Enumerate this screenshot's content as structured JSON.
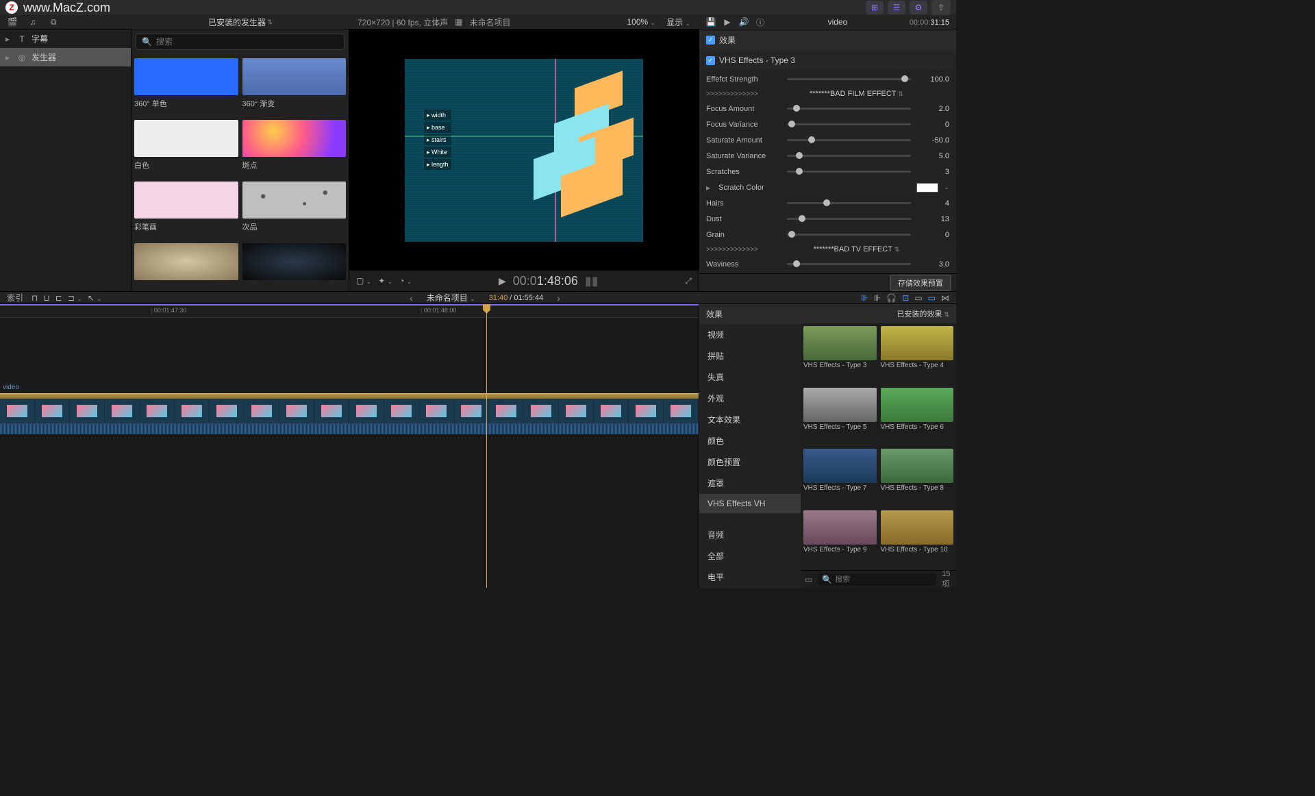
{
  "watermark": "www.MacZ.com",
  "logo_letter": "Z",
  "toolbar2": {
    "browser_title": "已安装的发生器",
    "viewer_meta": "720×720 | 60 fps, 立体声",
    "project_name": "未命名项目",
    "zoom": "100%",
    "display": "显示",
    "inspector_title": "video",
    "tc_prefix": "00:00:",
    "tc_end": "31:15"
  },
  "sidebar": {
    "items": [
      {
        "label": "字幕",
        "icon": "T"
      },
      {
        "label": "发生器",
        "icon": "◎"
      }
    ]
  },
  "browser": {
    "search_placeholder": "搜索",
    "generators": [
      {
        "label": "360° 单色",
        "css": "background: #2a6aff;"
      },
      {
        "label": "360° 渐变",
        "css": "background: linear-gradient(180deg,#6a8acf,#4a6aaa);"
      },
      {
        "label": "白色",
        "css": "background: #eee;"
      },
      {
        "label": "斑点",
        "css": "background: radial-gradient(circle at 30% 30%, #ffcc4a, #ff5a8a 40%, #8a3aff 80%);"
      },
      {
        "label": "彩笔画",
        "css": "background: #f5d5e5;"
      },
      {
        "label": "次品",
        "css": "background: #bfbfbf url() ; background-image: radial-gradient(circle at 20% 40%, #555 2%, transparent 3%), radial-gradient(circle at 60% 60%, #555 2%, transparent 3%), radial-gradient(circle at 80% 30%, #555 2%, transparent 3%); "
      },
      {
        "label": "",
        "css": "background: radial-gradient(ellipse at center, #d4c4a4, #8a7a5a);"
      },
      {
        "label": "",
        "css": "background: radial-gradient(ellipse at center, #2a3a4a, #0a0a0a);"
      }
    ]
  },
  "viewer": {
    "video_overlay_labels": [
      "width",
      "base",
      "stairs",
      "White",
      "length"
    ],
    "timecode_prefix": "00:0",
    "timecode_main": "1:48:06"
  },
  "inspector": {
    "section_effects": "效果",
    "effect_name": "VHS Effects - Type 3",
    "params": [
      {
        "label": "Effefct Strength",
        "value": "100.0",
        "pct": 95
      },
      {
        "label": "Focus Amount",
        "value": "2.0",
        "pct": 8
      },
      {
        "label": "Focus Variance",
        "value": "0",
        "pct": 4
      },
      {
        "label": "Saturate Amount",
        "value": "-50.0",
        "pct": 20
      },
      {
        "label": "Saturate Variance",
        "value": "5.0",
        "pct": 10
      },
      {
        "label": "Scratches",
        "value": "3",
        "pct": 10
      },
      {
        "label": "Hairs",
        "value": "4",
        "pct": 32
      },
      {
        "label": "Dust",
        "value": "13",
        "pct": 12
      },
      {
        "label": "Grain",
        "value": "0",
        "pct": 4
      },
      {
        "label": "Waviness",
        "value": "3.0",
        "pct": 8
      }
    ],
    "separator1_arrows": ">>>>>>>>>>>>>",
    "separator1_text": "*******BAD FILM EFFECT",
    "scratch_color_label": "Scratch Color",
    "separator2_arrows": ">>>>>>>>>>>>>",
    "separator2_text": "*******BAD TV EFFECT",
    "save_preset": "存储效果预置"
  },
  "timeline_header": {
    "index_btn": "索引",
    "project": "未命名项目",
    "time_current": "31:40",
    "time_sep": " / ",
    "time_total": "01:55:44"
  },
  "timeline": {
    "ruler_ticks": [
      "00:01:47:30",
      "00:01:48:00"
    ],
    "track_label": "video"
  },
  "fx": {
    "head": "效果",
    "installed": "已安装的效果",
    "categories": [
      {
        "label": "视频",
        "bold": true
      },
      {
        "label": "拼贴"
      },
      {
        "label": "失真"
      },
      {
        "label": "外观"
      },
      {
        "label": "文本效果"
      },
      {
        "label": "颜色"
      },
      {
        "label": "颜色预置"
      },
      {
        "label": "遮罩"
      },
      {
        "label": "VHS Effects VH",
        "selected": true
      },
      {
        "label": "音频",
        "bold": true,
        "gap": true
      },
      {
        "label": "全部"
      },
      {
        "label": "电平"
      }
    ],
    "results": [
      {
        "label": "VHS Effects - Type 3",
        "css": "background: linear-gradient(180deg,#7a9a5a,#4a6a3a);"
      },
      {
        "label": "VHS Effects - Type 4",
        "css": "background: linear-gradient(180deg,#c4b44a,#8a7a2a);"
      },
      {
        "label": "VHS Effects - Type 5",
        "css": "background: linear-gradient(180deg,#aaa,#666);"
      },
      {
        "label": "VHS Effects - Type 6",
        "css": "background: linear-gradient(180deg,#5aaa5a,#3a7a3a);"
      },
      {
        "label": "VHS Effects - Type 7",
        "css": "background: linear-gradient(180deg,#3a5a8a,#1a3a5a);"
      },
      {
        "label": "VHS Effects - Type 8",
        "css": "background: linear-gradient(180deg,#6a9a6a,#3a6a3a);"
      },
      {
        "label": "VHS Effects - Type 9",
        "css": "background: linear-gradient(180deg,#9a7a8a,#6a4a5a);"
      },
      {
        "label": "VHS Effects - Type 10",
        "css": "background: linear-gradient(180deg,#b49a4a,#8a6a2a);"
      }
    ],
    "search_placeholder": "搜索",
    "count": "15 项"
  }
}
